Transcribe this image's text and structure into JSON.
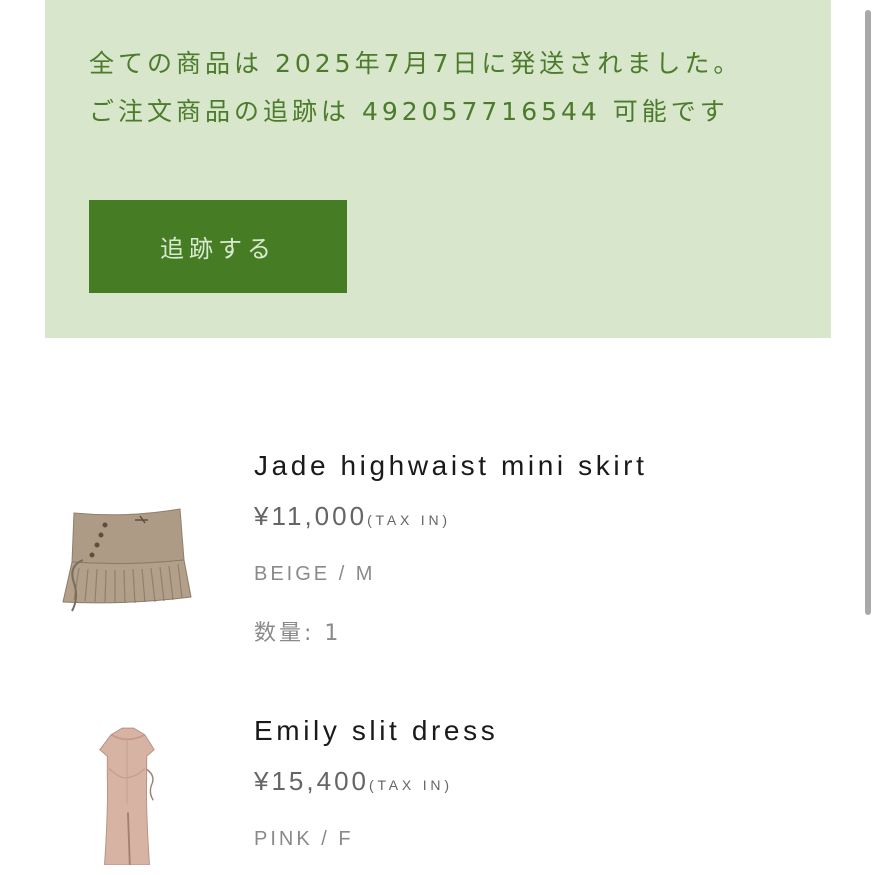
{
  "notice": {
    "message": "全ての商品は 2025年7月7日に発送されました。 ご注文商品の追跡は 492057716544 可能です",
    "track_button_label": "追跡する"
  },
  "colors": {
    "notice_background": "#d8e6cc",
    "notice_text": "#4c7b2b",
    "track_button": "#467c24",
    "track_button_text": "#d8ead0"
  },
  "order_items": [
    {
      "name": "Jade highwaist mini skirt",
      "price": "¥11,000",
      "tax_label": "(TAX IN)",
      "variant": "BEIGE / M",
      "quantity": "数量: 1",
      "image_icon": "beige-pleated-mini-skirt-image"
    },
    {
      "name": "Emily slit dress",
      "price": "¥15,400",
      "tax_label": "(TAX IN)",
      "variant": "PINK / F",
      "image_icon": "pink-slit-dress-image"
    }
  ]
}
